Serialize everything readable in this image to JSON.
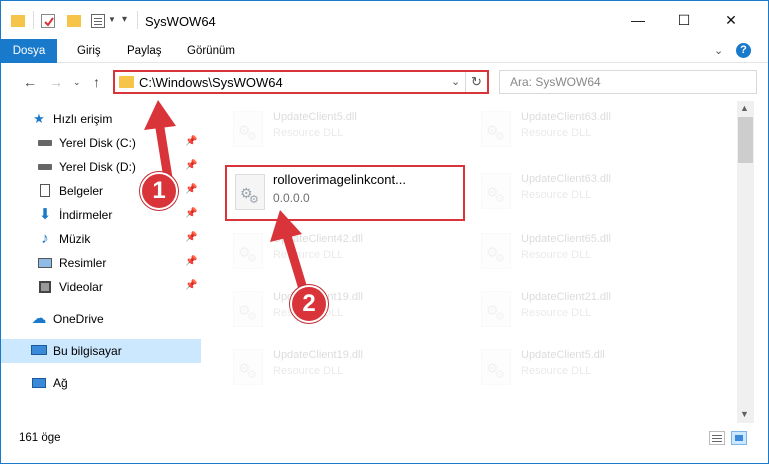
{
  "window": {
    "title": "SysWOW64",
    "minimize": "—",
    "maximize": "☐",
    "close": "✕"
  },
  "ribbon": {
    "tabs": [
      "Dosya",
      "Giriş",
      "Paylaş",
      "Görünüm"
    ],
    "help": "?"
  },
  "address": {
    "path": "C:\\Windows\\SysWOW64",
    "search_placeholder": "Ara: SysWOW64"
  },
  "nav_pane": {
    "items": [
      {
        "label": "Hızlı erişim",
        "icon": "star-icon",
        "pinned": false
      },
      {
        "label": "Yerel Disk (C:)",
        "icon": "drive-icon",
        "pinned": true
      },
      {
        "label": "Yerel Disk (D:)",
        "icon": "drive-icon",
        "pinned": true
      },
      {
        "label": "Belgeler",
        "icon": "documents-icon",
        "pinned": true
      },
      {
        "label": "İndirmeler",
        "icon": "download-icon",
        "pinned": true
      },
      {
        "label": "Müzik",
        "icon": "music-icon",
        "pinned": true
      },
      {
        "label": "Resimler",
        "icon": "pictures-icon",
        "pinned": true
      },
      {
        "label": "Videolar",
        "icon": "videos-icon",
        "pinned": true
      },
      {
        "label": "OneDrive",
        "icon": "cloud-icon",
        "pinned": false
      },
      {
        "label": "Bu bilgisayar",
        "icon": "computer-icon",
        "pinned": false,
        "selected": true
      },
      {
        "label": "Ağ",
        "icon": "network-icon",
        "pinned": false
      }
    ]
  },
  "files": {
    "highlighted": {
      "name": "rolloverimagelinkcont...",
      "detail": "0.0.0.0"
    },
    "left_column": [
      {
        "name": "UpdateClient5.dll",
        "detail": "Resource DLL"
      },
      {
        "name": "UpdateClient42.dll",
        "detail": "Resource DLL"
      },
      {
        "name": "UpdateClient19.dll",
        "detail": "Resource DLL"
      },
      {
        "name": "UpdateClient19.dll",
        "detail": "Resource DLL"
      }
    ],
    "right_column": [
      {
        "name": "UpdateClient63.dll",
        "detail": "Resource DLL"
      },
      {
        "name": "UpdateClient63.dll",
        "detail": "Resource DLL"
      },
      {
        "name": "UpdateClient65.dll",
        "detail": "Resource DLL"
      },
      {
        "name": "UpdateClient21.dll",
        "detail": "Resource DLL"
      },
      {
        "name": "UpdateClient5.dll",
        "detail": "Resource DLL"
      }
    ]
  },
  "status": {
    "item_count": "161 öge"
  },
  "annotations": {
    "step1": "1",
    "step2": "2"
  },
  "colors": {
    "accent": "#1979ca",
    "highlight": "#d9343a",
    "selection": "#cce8ff"
  }
}
